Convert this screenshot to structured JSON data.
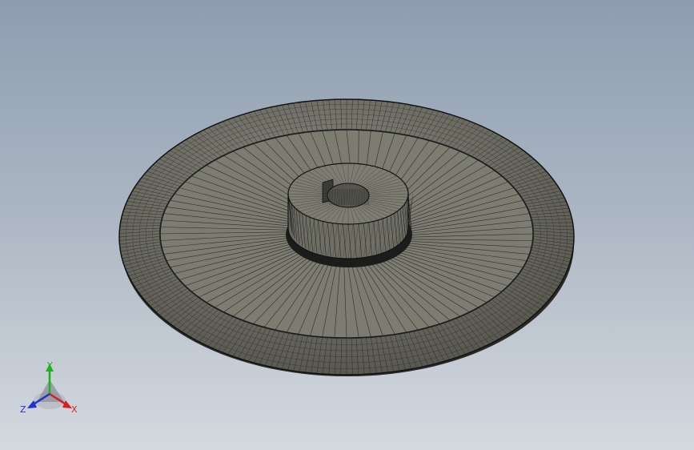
{
  "viewport": {
    "background_top": "#8d9db0",
    "background_bottom": "#d4d9df"
  },
  "model": {
    "fill": "#7b7b70",
    "wire": "#1b1b1b"
  },
  "triad": {
    "x_label": "X",
    "y_label": "Y",
    "z_label": "Z",
    "x_color": "#d81f1f",
    "y_color": "#1fb01f",
    "z_color": "#2030d0"
  }
}
